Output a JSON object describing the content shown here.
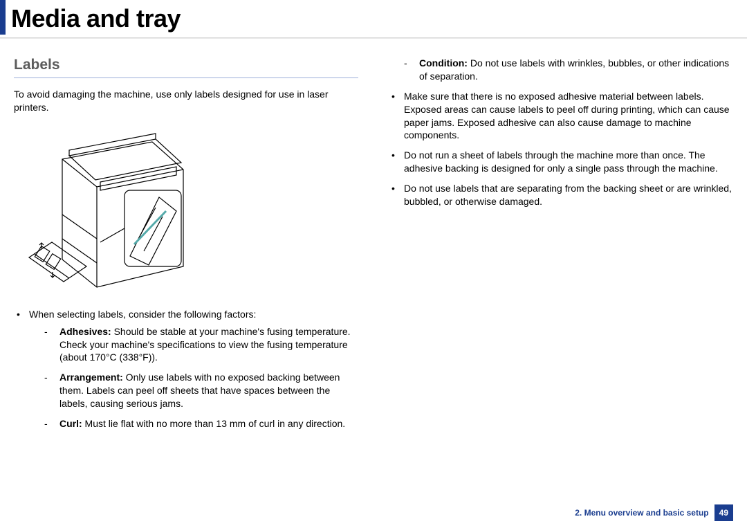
{
  "page_title": "Media and tray",
  "section_title": "Labels",
  "intro": "To avoid damaging the machine, use only labels designed for use in laser printers.",
  "left_bullet_lead": "When selecting labels, consider the following factors:",
  "sub_items": [
    {
      "label": "Adhesives:",
      "text": " Should be stable at your machine's fusing temperature. Check your machine's specifications to view the fusing temperature (about 170°C (338°F))."
    },
    {
      "label": "Arrangement:",
      "text": " Only use labels with no exposed backing between them. Labels can peel off sheets that have spaces between the labels, causing serious jams."
    },
    {
      "label": "Curl:",
      "text": " Must lie flat with no more than 13 mm of curl in any direction."
    }
  ],
  "right_sub": {
    "label": "Condition:",
    "text": " Do not use labels with wrinkles, bubbles, or other indications of separation."
  },
  "right_bullets": [
    "Make sure that there is no exposed adhesive material between labels. Exposed areas can cause labels to peel off during printing, which can cause paper jams. Exposed adhesive can also cause damage to machine components.",
    "Do not run a sheet of labels through the machine more than once. The adhesive backing is designed for only a single pass through the machine.",
    "Do not use labels that are separating from the backing sheet or are wrinkled, bubbled, or otherwise damaged."
  ],
  "footer_text": "2.  Menu overview and basic setup",
  "page_number": "49"
}
